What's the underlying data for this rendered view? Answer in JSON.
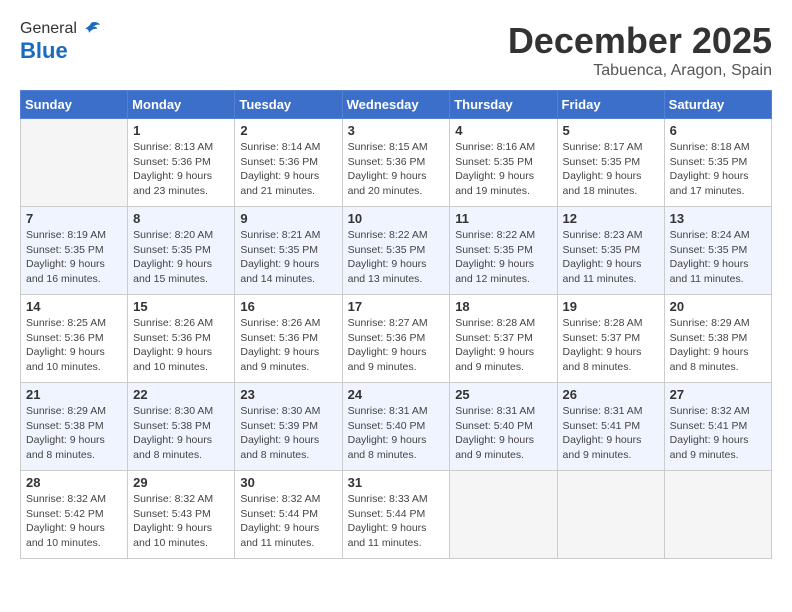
{
  "header": {
    "logo_general": "General",
    "logo_blue": "Blue",
    "month": "December 2025",
    "location": "Tabuenca, Aragon, Spain"
  },
  "days_of_week": [
    "Sunday",
    "Monday",
    "Tuesday",
    "Wednesday",
    "Thursday",
    "Friday",
    "Saturday"
  ],
  "weeks": [
    [
      {
        "day": "",
        "sunrise": "",
        "sunset": "",
        "daylight": ""
      },
      {
        "day": "1",
        "sunrise": "Sunrise: 8:13 AM",
        "sunset": "Sunset: 5:36 PM",
        "daylight": "Daylight: 9 hours and 23 minutes."
      },
      {
        "day": "2",
        "sunrise": "Sunrise: 8:14 AM",
        "sunset": "Sunset: 5:36 PM",
        "daylight": "Daylight: 9 hours and 21 minutes."
      },
      {
        "day": "3",
        "sunrise": "Sunrise: 8:15 AM",
        "sunset": "Sunset: 5:36 PM",
        "daylight": "Daylight: 9 hours and 20 minutes."
      },
      {
        "day": "4",
        "sunrise": "Sunrise: 8:16 AM",
        "sunset": "Sunset: 5:35 PM",
        "daylight": "Daylight: 9 hours and 19 minutes."
      },
      {
        "day": "5",
        "sunrise": "Sunrise: 8:17 AM",
        "sunset": "Sunset: 5:35 PM",
        "daylight": "Daylight: 9 hours and 18 minutes."
      },
      {
        "day": "6",
        "sunrise": "Sunrise: 8:18 AM",
        "sunset": "Sunset: 5:35 PM",
        "daylight": "Daylight: 9 hours and 17 minutes."
      }
    ],
    [
      {
        "day": "7",
        "sunrise": "Sunrise: 8:19 AM",
        "sunset": "Sunset: 5:35 PM",
        "daylight": "Daylight: 9 hours and 16 minutes."
      },
      {
        "day": "8",
        "sunrise": "Sunrise: 8:20 AM",
        "sunset": "Sunset: 5:35 PM",
        "daylight": "Daylight: 9 hours and 15 minutes."
      },
      {
        "day": "9",
        "sunrise": "Sunrise: 8:21 AM",
        "sunset": "Sunset: 5:35 PM",
        "daylight": "Daylight: 9 hours and 14 minutes."
      },
      {
        "day": "10",
        "sunrise": "Sunrise: 8:22 AM",
        "sunset": "Sunset: 5:35 PM",
        "daylight": "Daylight: 9 hours and 13 minutes."
      },
      {
        "day": "11",
        "sunrise": "Sunrise: 8:22 AM",
        "sunset": "Sunset: 5:35 PM",
        "daylight": "Daylight: 9 hours and 12 minutes."
      },
      {
        "day": "12",
        "sunrise": "Sunrise: 8:23 AM",
        "sunset": "Sunset: 5:35 PM",
        "daylight": "Daylight: 9 hours and 11 minutes."
      },
      {
        "day": "13",
        "sunrise": "Sunrise: 8:24 AM",
        "sunset": "Sunset: 5:35 PM",
        "daylight": "Daylight: 9 hours and 11 minutes."
      }
    ],
    [
      {
        "day": "14",
        "sunrise": "Sunrise: 8:25 AM",
        "sunset": "Sunset: 5:36 PM",
        "daylight": "Daylight: 9 hours and 10 minutes."
      },
      {
        "day": "15",
        "sunrise": "Sunrise: 8:26 AM",
        "sunset": "Sunset: 5:36 PM",
        "daylight": "Daylight: 9 hours and 10 minutes."
      },
      {
        "day": "16",
        "sunrise": "Sunrise: 8:26 AM",
        "sunset": "Sunset: 5:36 PM",
        "daylight": "Daylight: 9 hours and 9 minutes."
      },
      {
        "day": "17",
        "sunrise": "Sunrise: 8:27 AM",
        "sunset": "Sunset: 5:36 PM",
        "daylight": "Daylight: 9 hours and 9 minutes."
      },
      {
        "day": "18",
        "sunrise": "Sunrise: 8:28 AM",
        "sunset": "Sunset: 5:37 PM",
        "daylight": "Daylight: 9 hours and 9 minutes."
      },
      {
        "day": "19",
        "sunrise": "Sunrise: 8:28 AM",
        "sunset": "Sunset: 5:37 PM",
        "daylight": "Daylight: 9 hours and 8 minutes."
      },
      {
        "day": "20",
        "sunrise": "Sunrise: 8:29 AM",
        "sunset": "Sunset: 5:38 PM",
        "daylight": "Daylight: 9 hours and 8 minutes."
      }
    ],
    [
      {
        "day": "21",
        "sunrise": "Sunrise: 8:29 AM",
        "sunset": "Sunset: 5:38 PM",
        "daylight": "Daylight: 9 hours and 8 minutes."
      },
      {
        "day": "22",
        "sunrise": "Sunrise: 8:30 AM",
        "sunset": "Sunset: 5:38 PM",
        "daylight": "Daylight: 9 hours and 8 minutes."
      },
      {
        "day": "23",
        "sunrise": "Sunrise: 8:30 AM",
        "sunset": "Sunset: 5:39 PM",
        "daylight": "Daylight: 9 hours and 8 minutes."
      },
      {
        "day": "24",
        "sunrise": "Sunrise: 8:31 AM",
        "sunset": "Sunset: 5:40 PM",
        "daylight": "Daylight: 9 hours and 8 minutes."
      },
      {
        "day": "25",
        "sunrise": "Sunrise: 8:31 AM",
        "sunset": "Sunset: 5:40 PM",
        "daylight": "Daylight: 9 hours and 9 minutes."
      },
      {
        "day": "26",
        "sunrise": "Sunrise: 8:31 AM",
        "sunset": "Sunset: 5:41 PM",
        "daylight": "Daylight: 9 hours and 9 minutes."
      },
      {
        "day": "27",
        "sunrise": "Sunrise: 8:32 AM",
        "sunset": "Sunset: 5:41 PM",
        "daylight": "Daylight: 9 hours and 9 minutes."
      }
    ],
    [
      {
        "day": "28",
        "sunrise": "Sunrise: 8:32 AM",
        "sunset": "Sunset: 5:42 PM",
        "daylight": "Daylight: 9 hours and 10 minutes."
      },
      {
        "day": "29",
        "sunrise": "Sunrise: 8:32 AM",
        "sunset": "Sunset: 5:43 PM",
        "daylight": "Daylight: 9 hours and 10 minutes."
      },
      {
        "day": "30",
        "sunrise": "Sunrise: 8:32 AM",
        "sunset": "Sunset: 5:44 PM",
        "daylight": "Daylight: 9 hours and 11 minutes."
      },
      {
        "day": "31",
        "sunrise": "Sunrise: 8:33 AM",
        "sunset": "Sunset: 5:44 PM",
        "daylight": "Daylight: 9 hours and 11 minutes."
      },
      {
        "day": "",
        "sunrise": "",
        "sunset": "",
        "daylight": ""
      },
      {
        "day": "",
        "sunrise": "",
        "sunset": "",
        "daylight": ""
      },
      {
        "day": "",
        "sunrise": "",
        "sunset": "",
        "daylight": ""
      }
    ]
  ]
}
